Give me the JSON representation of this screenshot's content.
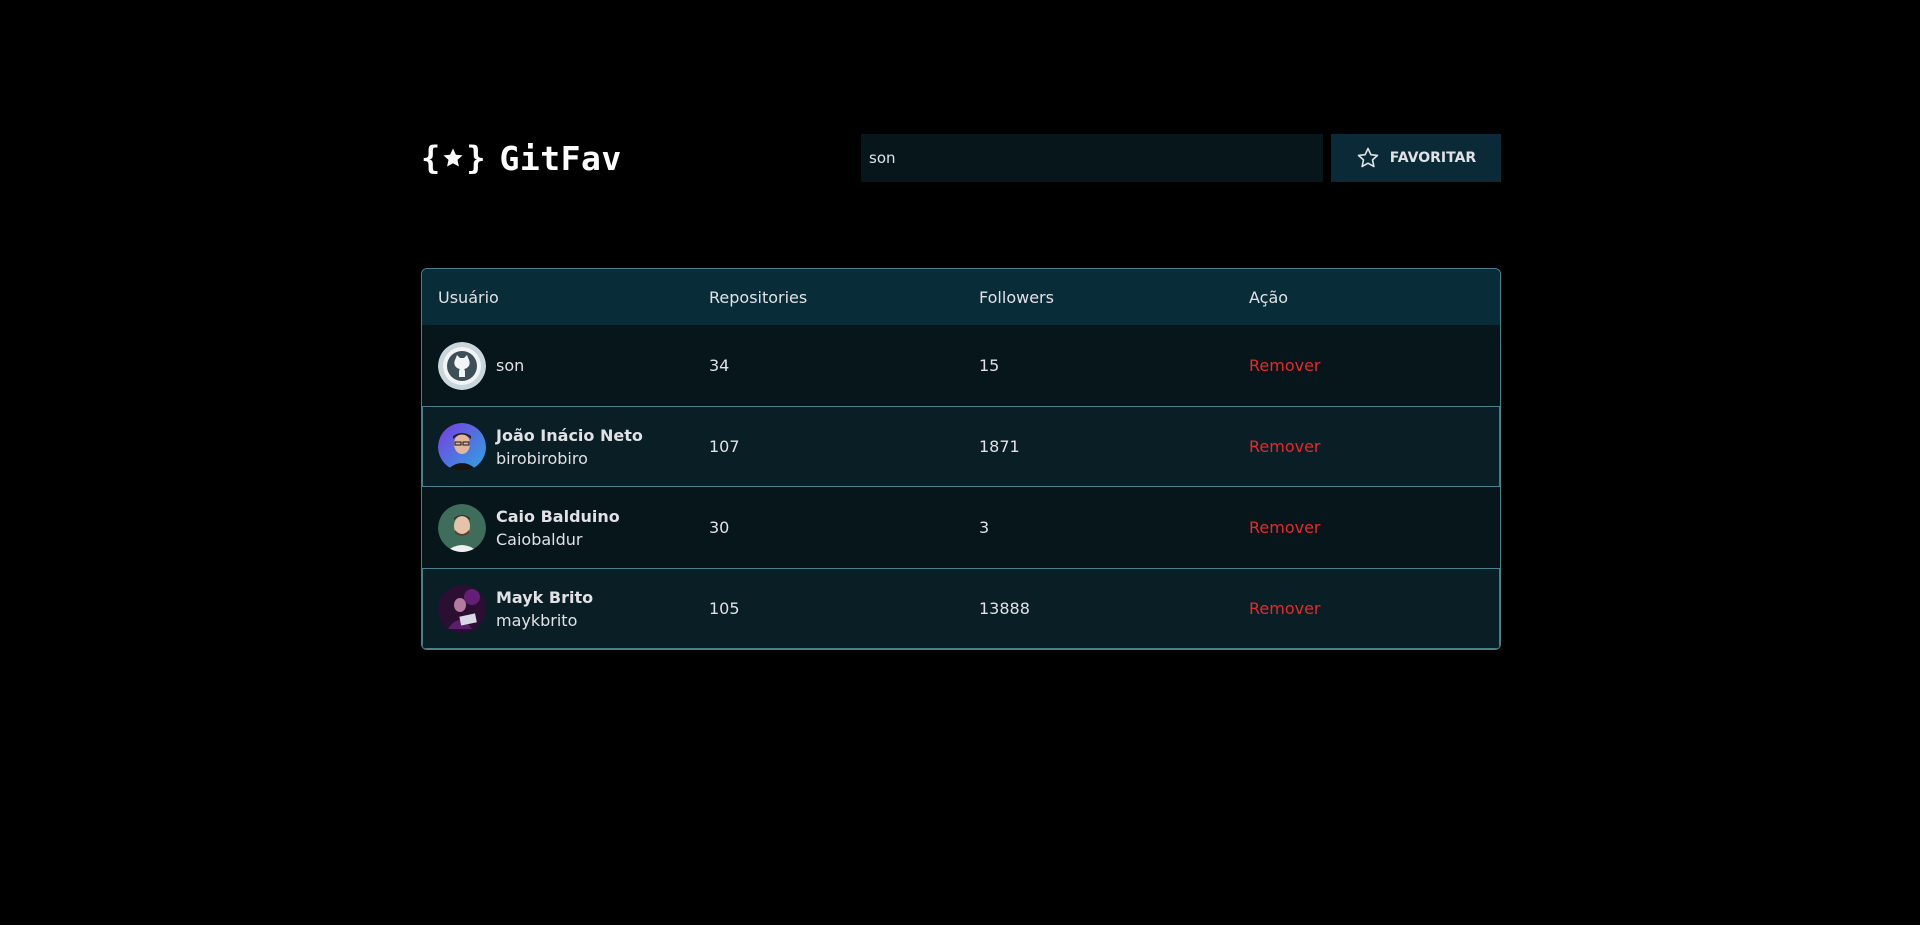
{
  "header": {
    "logo_text": "GitFav",
    "search_value": "son",
    "favorite_label": "FAVORITAR"
  },
  "table": {
    "columns": [
      "Usuário",
      "Repositories",
      "Followers",
      "Ação"
    ],
    "rows": [
      {
        "name": "",
        "login": "son",
        "repositories": "34",
        "followers": "15",
        "action": "Remover",
        "avatar": "github-octocat"
      },
      {
        "name": "João Inácio Neto",
        "login": "birobirobiro",
        "repositories": "107",
        "followers": "1871",
        "action": "Remover",
        "avatar": "photo"
      },
      {
        "name": "Caio Balduino",
        "login": "Caiobaldur",
        "repositories": "30",
        "followers": "3",
        "action": "Remover",
        "avatar": "photo"
      },
      {
        "name": "Mayk Brito",
        "login": "maykbrito",
        "repositories": "105",
        "followers": "13888",
        "action": "Remover",
        "avatar": "photo"
      }
    ]
  },
  "colors": {
    "background": "#000000",
    "header_row": "#092d38",
    "border": "#4a808c",
    "remove": "#e32b2b"
  }
}
